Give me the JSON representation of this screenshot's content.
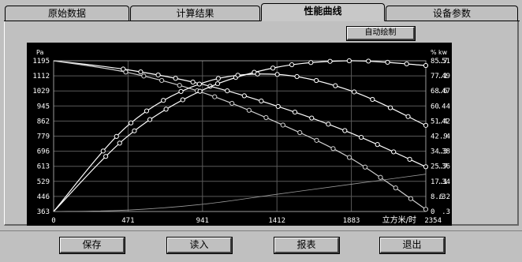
{
  "tabs": [
    {
      "label": "原始数据"
    },
    {
      "label": "计算结果"
    },
    {
      "label": "性能曲线"
    },
    {
      "label": "设备参数"
    }
  ],
  "active_tab": "性能曲线",
  "auto_draw_label": "自动绘制",
  "footer_buttons": {
    "save": "保存",
    "load": "读入",
    "report": "报表",
    "exit": "退出"
  },
  "chart_data": {
    "type": "line",
    "background": "#000000",
    "grid": true,
    "left_axis_unit": "Pa",
    "right_axis_units": [
      "%",
      "kw"
    ],
    "x_axis_unit": "立方米/时",
    "x_ticks": [
      "0",
      "471",
      "941",
      "1412",
      "1883",
      "2354"
    ],
    "y_ticks_pa": [
      "363",
      "446",
      "529",
      "613",
      "696",
      "779",
      "862",
      "945",
      "1029",
      "1112",
      "1195"
    ],
    "y_ticks_pct": [
      "0",
      "8.6",
      "17.1",
      "25.7",
      "34.3",
      "42.9",
      "51.4",
      "60",
      "68.6",
      "77.1",
      "85.7"
    ],
    "y_ticks_kw": [
      ".3",
      ".32",
      ".34",
      ".36",
      ".38",
      ".4",
      ".42",
      ".44",
      ".47",
      ".49",
      ".51"
    ],
    "xlim": [
      0,
      2354
    ],
    "ylim_pa": [
      363,
      1195
    ],
    "ylim_pct": [
      0,
      85.7
    ],
    "ylim_kw": [
      0.3,
      0.51
    ],
    "series": [
      {
        "axis": "pa",
        "x": [
          0,
          471,
          941,
          1412,
          1883,
          2354
        ],
        "y": [
          1195,
          1145,
          1065,
          945,
          795,
          610
        ]
      },
      {
        "axis": "pa",
        "x": [
          0,
          471,
          941,
          1412,
          1883,
          2354
        ],
        "y": [
          1195,
          1130,
          1020,
          855,
          655,
          375
        ]
      },
      {
        "axis": "pct",
        "x": [
          0,
          471,
          941,
          1412,
          1883,
          2354
        ],
        "y": [
          0,
          43,
          69,
          82,
          85.7,
          83
        ]
      },
      {
        "axis": "kw",
        "x": [
          0,
          471,
          941,
          1412,
          1883,
          2354
        ],
        "y": [
          0.3,
          0.42,
          0.479,
          0.491,
          0.468,
          0.42
        ]
      },
      {
        "axis": "kw",
        "x": [
          0,
          471,
          941,
          1412,
          1883,
          2354
        ],
        "y": [
          0.3,
          0.302,
          0.31,
          0.324,
          0.338,
          0.352
        ]
      }
    ]
  }
}
